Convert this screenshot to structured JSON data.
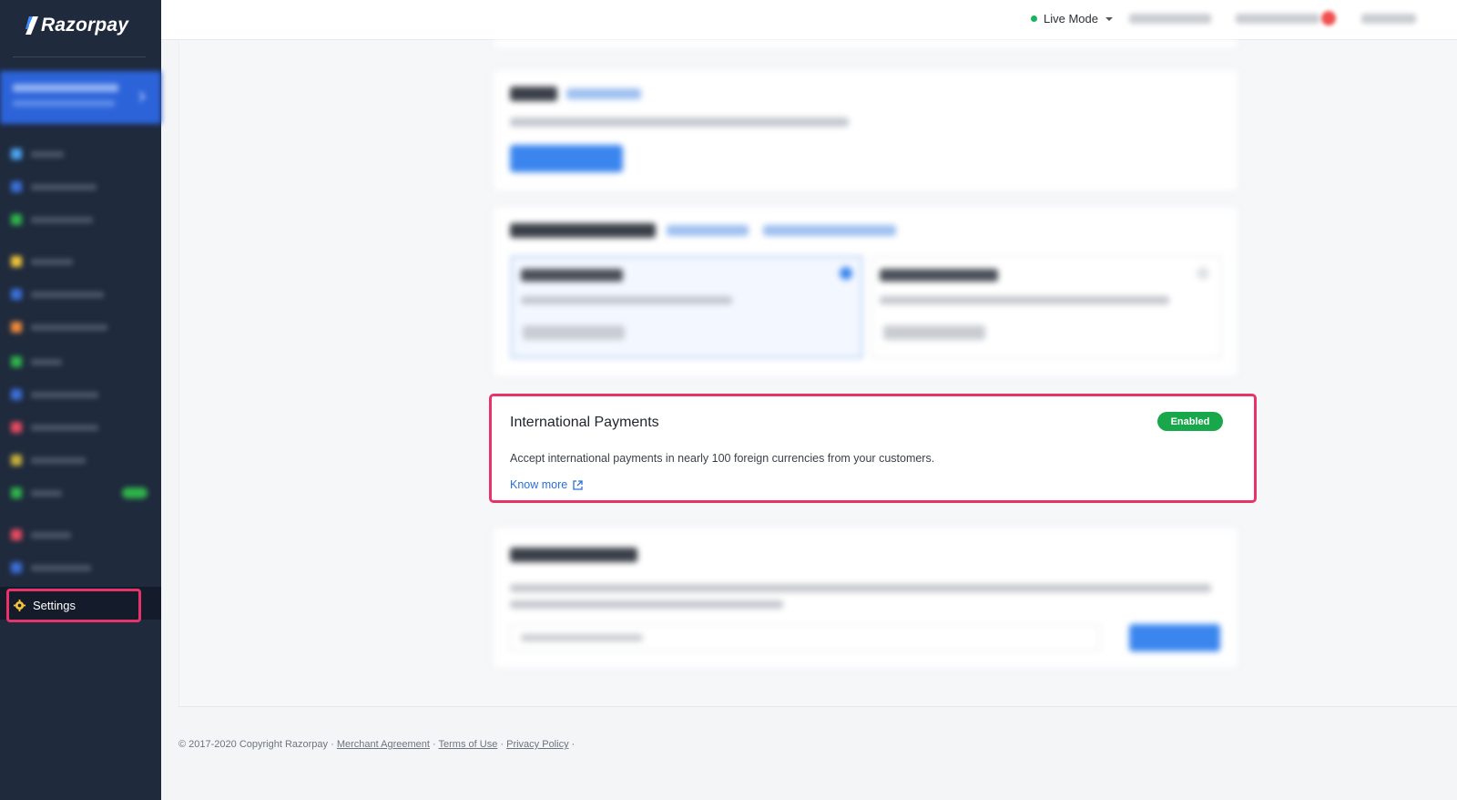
{
  "app": {
    "brand": "Razorpay"
  },
  "topbar": {
    "mode_label": "Live Mode"
  },
  "sidebar": {
    "settings_label": "Settings"
  },
  "intl_payments": {
    "title": "International Payments",
    "status": "Enabled",
    "description": "Accept international payments in nearly 100 foreign currencies from your customers.",
    "link": "Know more"
  },
  "footer": {
    "copyright": "© 2017-2020 Copyright Razorpay",
    "links": [
      "Merchant Agreement",
      "Terms of Use",
      "Privacy Policy"
    ]
  },
  "colors": {
    "sidebar": "#1f2a3d",
    "accent": "#2a6fd6",
    "enabled": "#18a84b",
    "highlight": "#e8336a"
  }
}
